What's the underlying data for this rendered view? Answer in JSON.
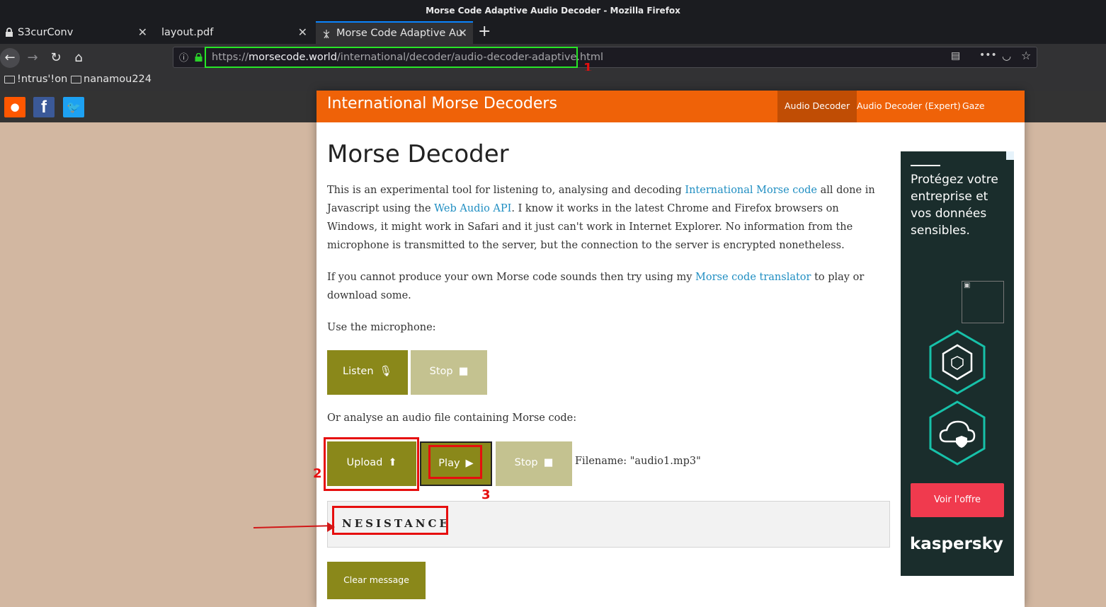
{
  "window": {
    "title": "Morse Code Adaptive Audio Decoder - Mozilla Firefox"
  },
  "tabs": [
    {
      "label": "S3curConv",
      "active": false
    },
    {
      "label": "layout.pdf",
      "active": false
    },
    {
      "label": "Morse Code Adaptive Au",
      "active": true
    }
  ],
  "url": {
    "prefix": "https://",
    "host": "morsecode.world",
    "path": "/international/decoder/audio-decoder-adaptive.html"
  },
  "bookmarks": [
    "!ntrus'!on",
    "nanamou224"
  ],
  "site": {
    "title": "International Morse Decoders",
    "nav": [
      "Audio Decoder",
      "Audio Decoder (Expert)",
      "Gaze Decoder"
    ]
  },
  "content": {
    "heading": "Morse Decoder",
    "p1": {
      "t1": "This is an experimental tool for listening to, analysing and decoding ",
      "link1": "International Morse code",
      "t2": " all done in Javascript using the ",
      "link2": "Web Audio API",
      "t3": ". I know it works in the latest Chrome and Firefox browsers on Windows, it might work in Safari and it just can't work in Internet Explorer. No information from the microphone is transmitted to the server, but the connection to the server is encrypted nonetheless."
    },
    "p2": {
      "t1": "If you cannot produce your own Morse code sounds then try using my ",
      "link": "Morse code translator",
      "t2": " to play or download some."
    },
    "mic_label": "Use the microphone:",
    "listen_label": "Listen",
    "stop_label": "Stop",
    "file_label": "Or analyse an audio file containing Morse code:",
    "upload_label": "Upload",
    "play_label": "Play",
    "filename": "Filename: \"audio1.mp3\"",
    "decoded": "NESISTANCE",
    "clear_label": "Clear message"
  },
  "ad": {
    "text": "Protégez votre entreprise et vos données sensibles.",
    "button": "Voir l'offre",
    "brand": "kaspersky"
  },
  "annotations": [
    "1",
    "2",
    "3"
  ],
  "colors": {
    "accent": "#ef6208",
    "button": "#8a881a",
    "annotation_red": "#e60e0e",
    "url_highlight": "#27e627"
  }
}
